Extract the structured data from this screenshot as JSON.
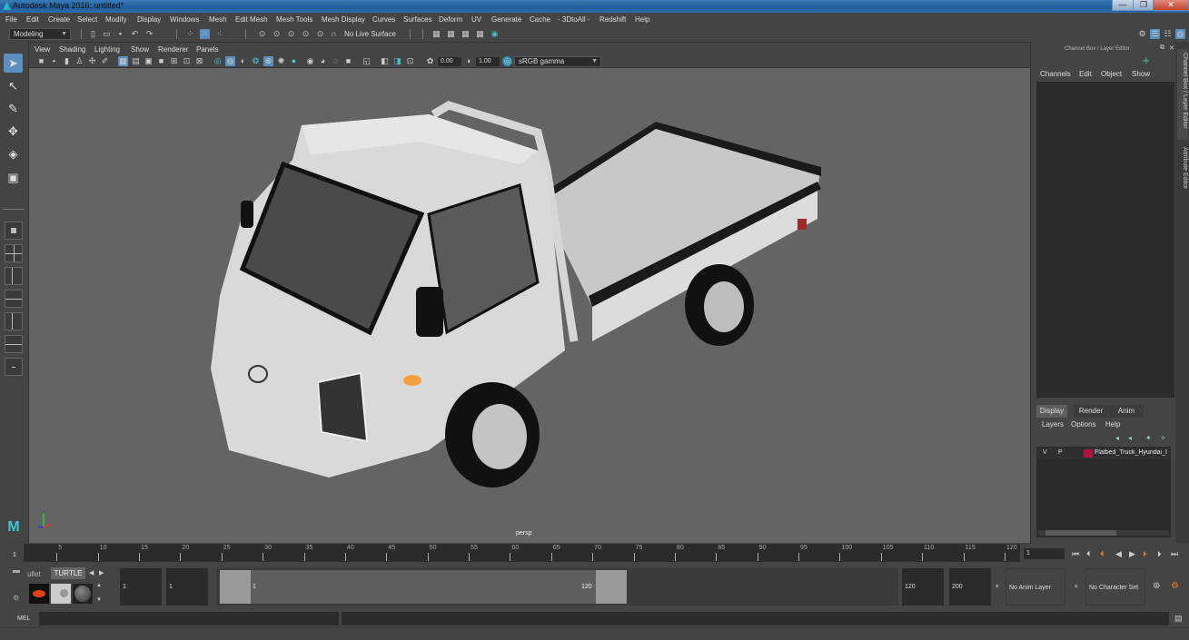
{
  "window": {
    "title": "Autodesk Maya 2016: untitled*",
    "minimize": "—",
    "maximize": "❐",
    "close": "✕"
  },
  "menubar": [
    "File",
    "Edit",
    "Create",
    "Select",
    "Modify",
    "Display",
    "Windows",
    "Mesh",
    "Edit Mesh",
    "Mesh Tools",
    "Mesh Display",
    "Curves",
    "Surfaces",
    "Deform",
    "UV",
    "Generate",
    "Cache",
    "- 3DtoAll -",
    "Redshift",
    "Help"
  ],
  "toolbar": {
    "mode": "Modeling",
    "live_surface": "No Live Surface"
  },
  "viewport": {
    "menu": [
      "View",
      "Shading",
      "Lighting",
      "Show",
      "Renderer",
      "Panels"
    ],
    "exposure": "0.00",
    "gamma": "1.00",
    "color_space": "sRGB gamma",
    "camera_label": "persp"
  },
  "channel_box": {
    "title": "Channel Box / Layer Editor",
    "menu": [
      "Channels",
      "Edit",
      "Object",
      "Show"
    ],
    "side_tabs": [
      "Channel Box / Layer Editor",
      "Attribute Editor"
    ]
  },
  "layer_editor": {
    "tabs": [
      "Display",
      "Render",
      "Anim"
    ],
    "active_tab": "Display",
    "menu": [
      "Layers",
      "Options",
      "Help"
    ],
    "layers": [
      {
        "visible": "V",
        "playback": "P",
        "color": "#b0143c",
        "name": "Flatbed_Truck_Hyundai_I"
      }
    ]
  },
  "timeline": {
    "ticks": [
      "5",
      "10",
      "15",
      "20",
      "25",
      "30",
      "35",
      "40",
      "45",
      "50",
      "55",
      "60",
      "65",
      "70",
      "75",
      "80",
      "85",
      "90",
      "95",
      "100",
      "105",
      "110",
      "115",
      "120"
    ],
    "start_marker": "1",
    "current_frame": "1"
  },
  "range": {
    "shelf_tabs": [
      "ullet",
      "TURTLE"
    ],
    "start_time": "1",
    "playback_start": "1",
    "range_start_label": "1",
    "range_end_label": "120",
    "playback_end": "120",
    "end_time": "200",
    "anim_layer": "No Anim Layer",
    "character_set": "No Character Set"
  },
  "command_line": {
    "label": "MEL",
    "value": ""
  },
  "colors": {
    "accent": "#5a8fbf",
    "viewport_bg": "#646464",
    "panel_bg": "#444444",
    "layer_color": "#b0143c"
  }
}
